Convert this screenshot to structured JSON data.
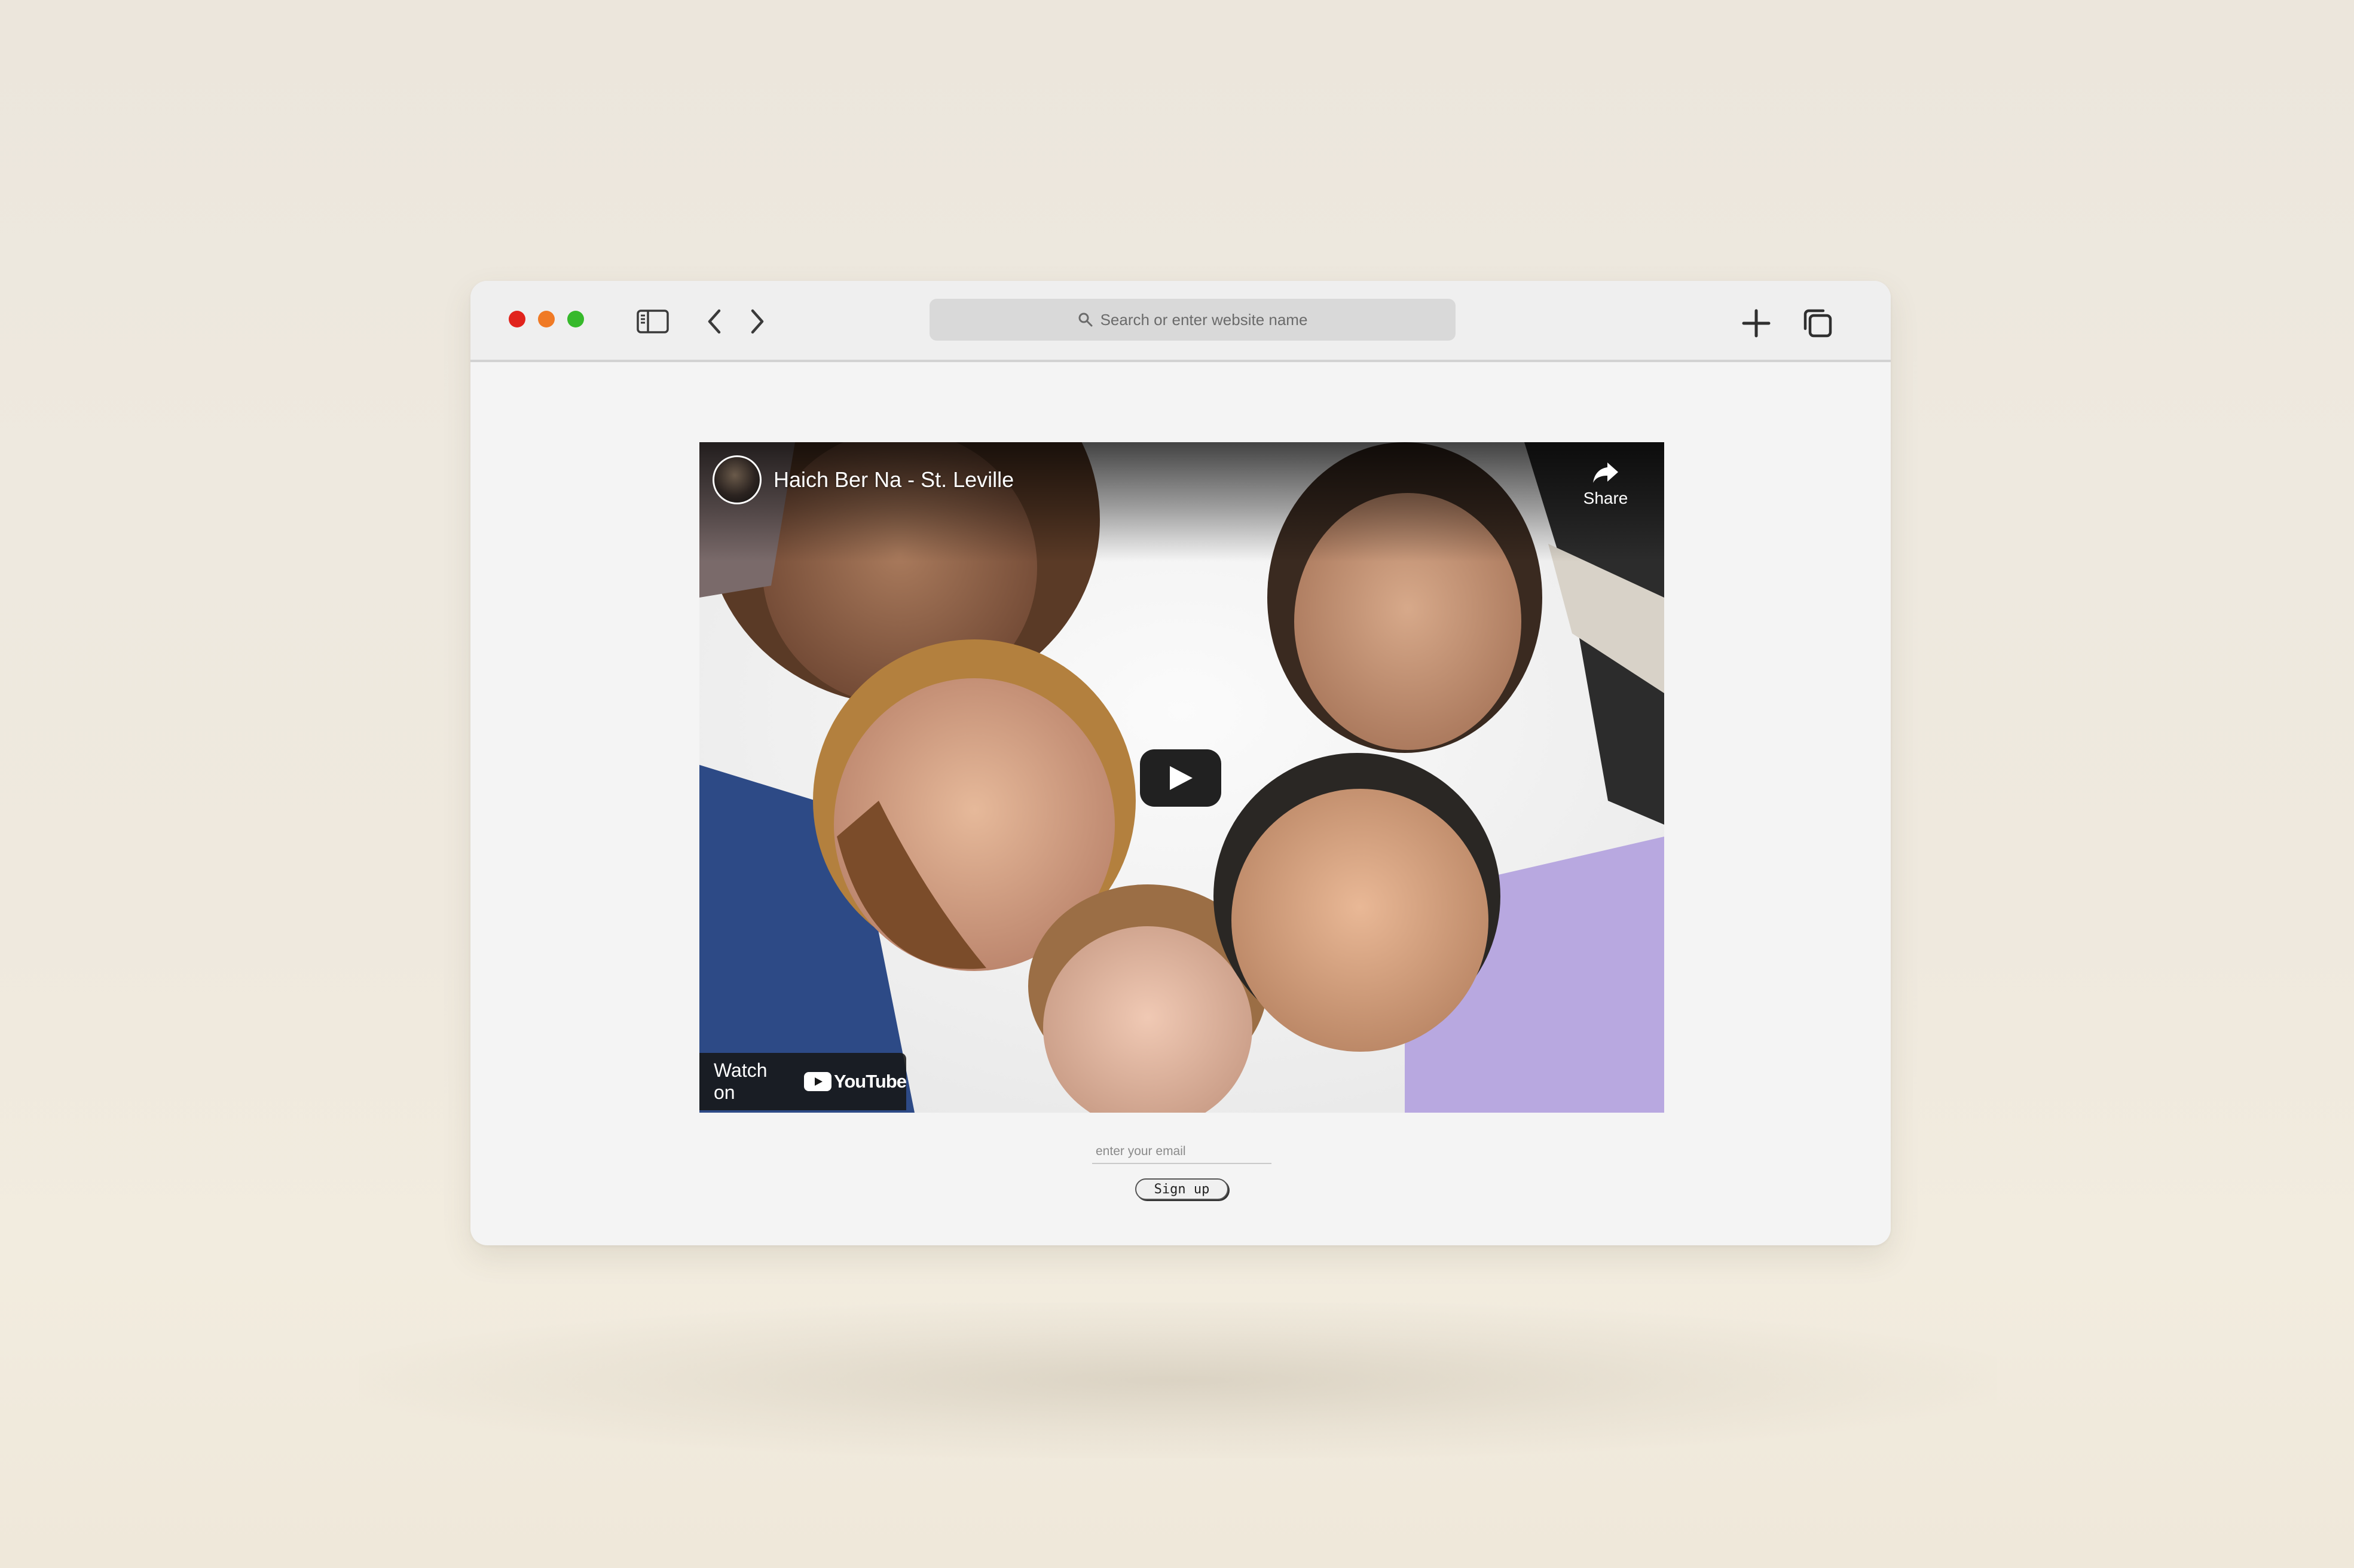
{
  "browser": {
    "address_placeholder": "Search or enter website name",
    "traffic_lights": [
      "#e1231c",
      "#f07a25",
      "#36b92b"
    ]
  },
  "video": {
    "title": "Haich Ber Na - St. Leville",
    "share_label": "Share",
    "watch_on_label": "Watch on",
    "youtube_wordmark": "YouTube"
  },
  "form": {
    "email_placeholder": "enter your email",
    "signup_label": "Sign up"
  }
}
